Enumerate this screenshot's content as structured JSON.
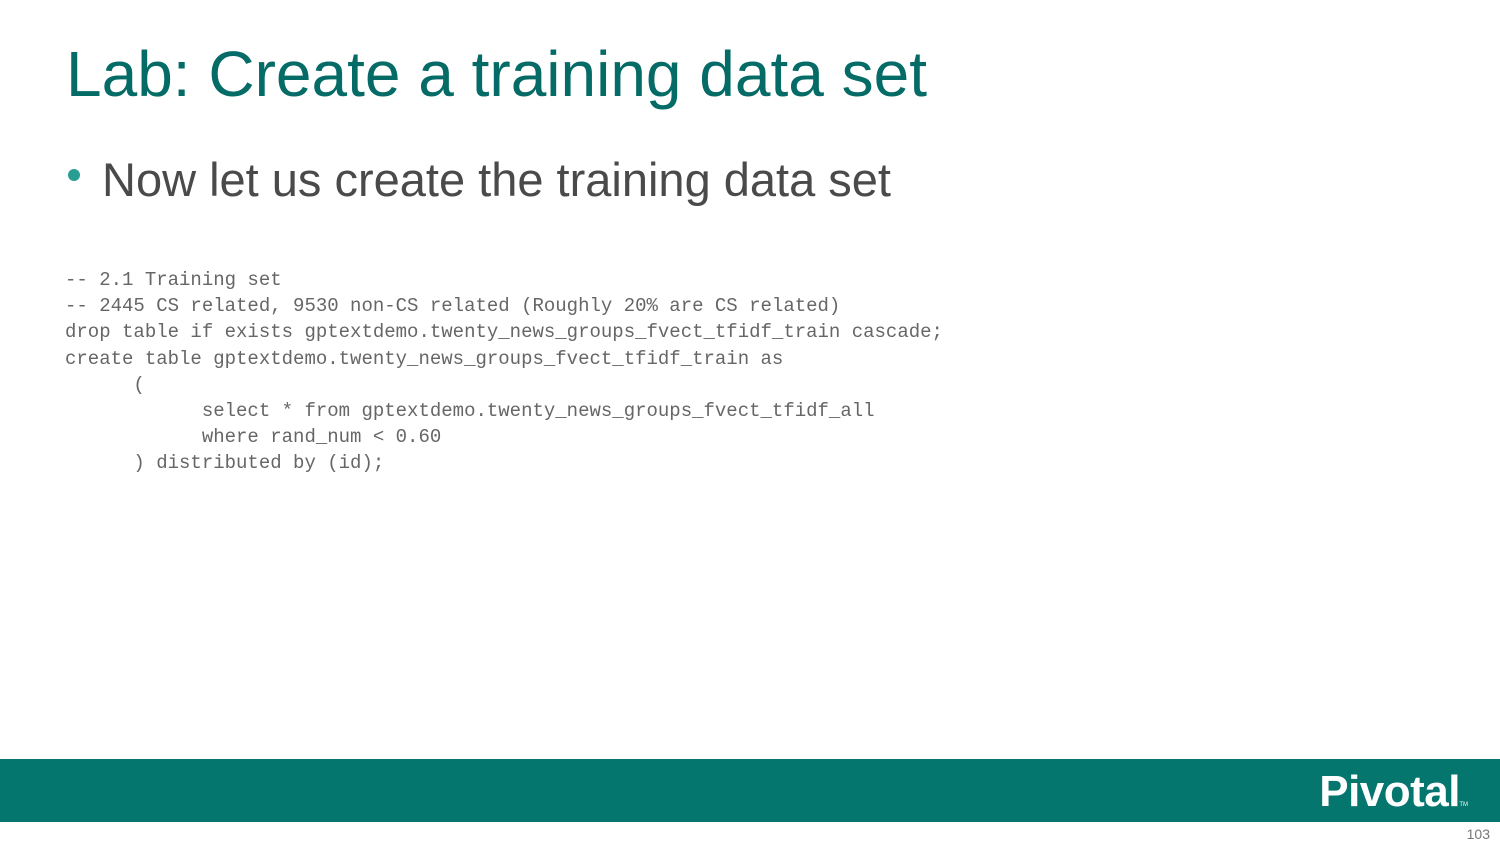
{
  "slide": {
    "title": "Lab: Create a training data set",
    "bullets": [
      "Now let us create the training data set"
    ],
    "code_lines": [
      "-- 2.1 Training set",
      "-- 2445 CS related, 9530 non-CS related (Roughly 20% are CS related)",
      "drop table if exists gptextdemo.twenty_news_groups_fvect_tfidf_train cascade;",
      "create table gptextdemo.twenty_news_groups_fvect_tfidf_train as",
      "      (",
      "            select * from gptextdemo.twenty_news_groups_fvect_tfidf_all",
      "            where rand_num < 0.60",
      "      ) distributed by (id);"
    ],
    "page_number": "103"
  },
  "footer": {
    "logo_text": "Pivotal",
    "logo_tm": "TM",
    "band_color": "#04766d"
  },
  "colors": {
    "title": "#046b66",
    "bullet_dot": "#2a9d92",
    "body_text": "#4a4a4a",
    "code_text": "#666666"
  }
}
